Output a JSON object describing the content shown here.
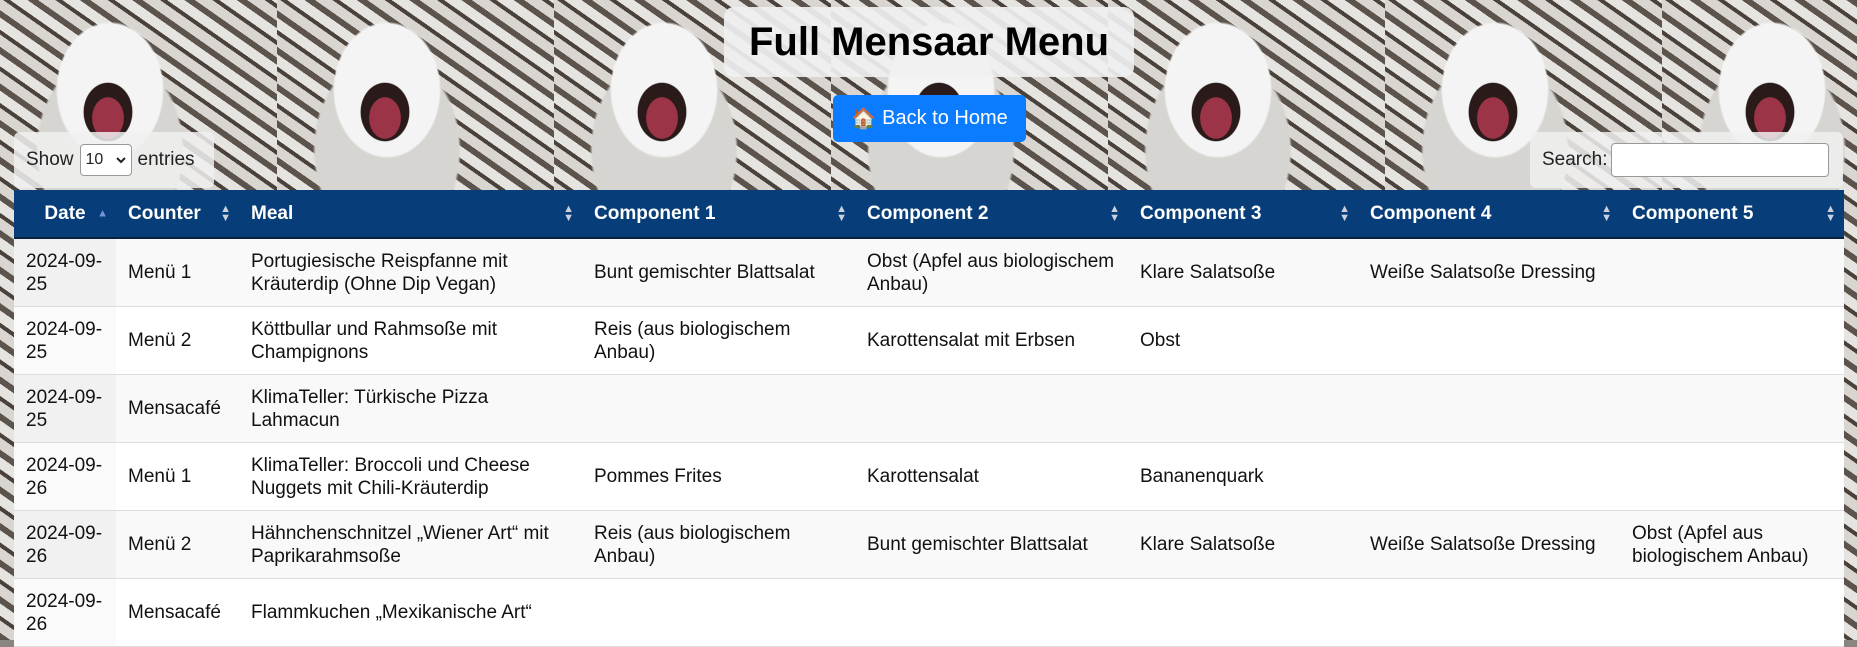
{
  "page": {
    "title": "Full Mensaar Menu",
    "back_button_icon": "🏠",
    "back_button_label": "Back to Home"
  },
  "controls": {
    "show_label": "Show",
    "entries_value": "10",
    "entries_label": "entries",
    "search_label": "Search:",
    "search_value": ""
  },
  "table": {
    "columns": [
      "Date",
      "Counter",
      "Meal",
      "Component 1",
      "Component 2",
      "Component 3",
      "Component 4",
      "Component 5"
    ],
    "rows": [
      [
        "2024-09-25",
        "Menü 1",
        "Portugiesische Reispfanne mit Kräuterdip (Ohne Dip Vegan)",
        "Bunt gemischter Blattsalat",
        "Obst (Apfel aus biologischem Anbau)",
        "Klare Salatsoße",
        "Weiße Salatsoße Dressing",
        ""
      ],
      [
        "2024-09-25",
        "Menü 2",
        "Köttbullar und Rahmsoße mit Champignons",
        "Reis (aus biologischem Anbau)",
        "Karottensalat mit Erbsen",
        "Obst",
        "",
        ""
      ],
      [
        "2024-09-25",
        "Mensacafé",
        "KlimaTeller: Türkische Pizza Lahmacun",
        "",
        "",
        "",
        "",
        ""
      ],
      [
        "2024-09-26",
        "Menü 1",
        "KlimaTeller: Broccoli und Cheese Nuggets mit Chili-Kräuterdip",
        "Pommes Frites",
        "Karottensalat",
        "Bananenquark",
        "",
        ""
      ],
      [
        "2024-09-26",
        "Menü 2",
        "Hähnchenschnitzel „Wiener Art“ mit Paprikarahmsoße",
        "Reis (aus biologischem Anbau)",
        "Bunt gemischter Blattsalat",
        "Klare Salatsoße",
        "Weiße Salatsoße Dressing",
        "Obst (Apfel aus biologischem Anbau)"
      ],
      [
        "2024-09-26",
        "Mensacafé",
        "Flammkuchen „Mexikanische Art“",
        "",
        "",
        "",
        "",
        ""
      ]
    ]
  },
  "colors": {
    "header_bg": "#073d78",
    "button_bg": "#0b7cff"
  }
}
